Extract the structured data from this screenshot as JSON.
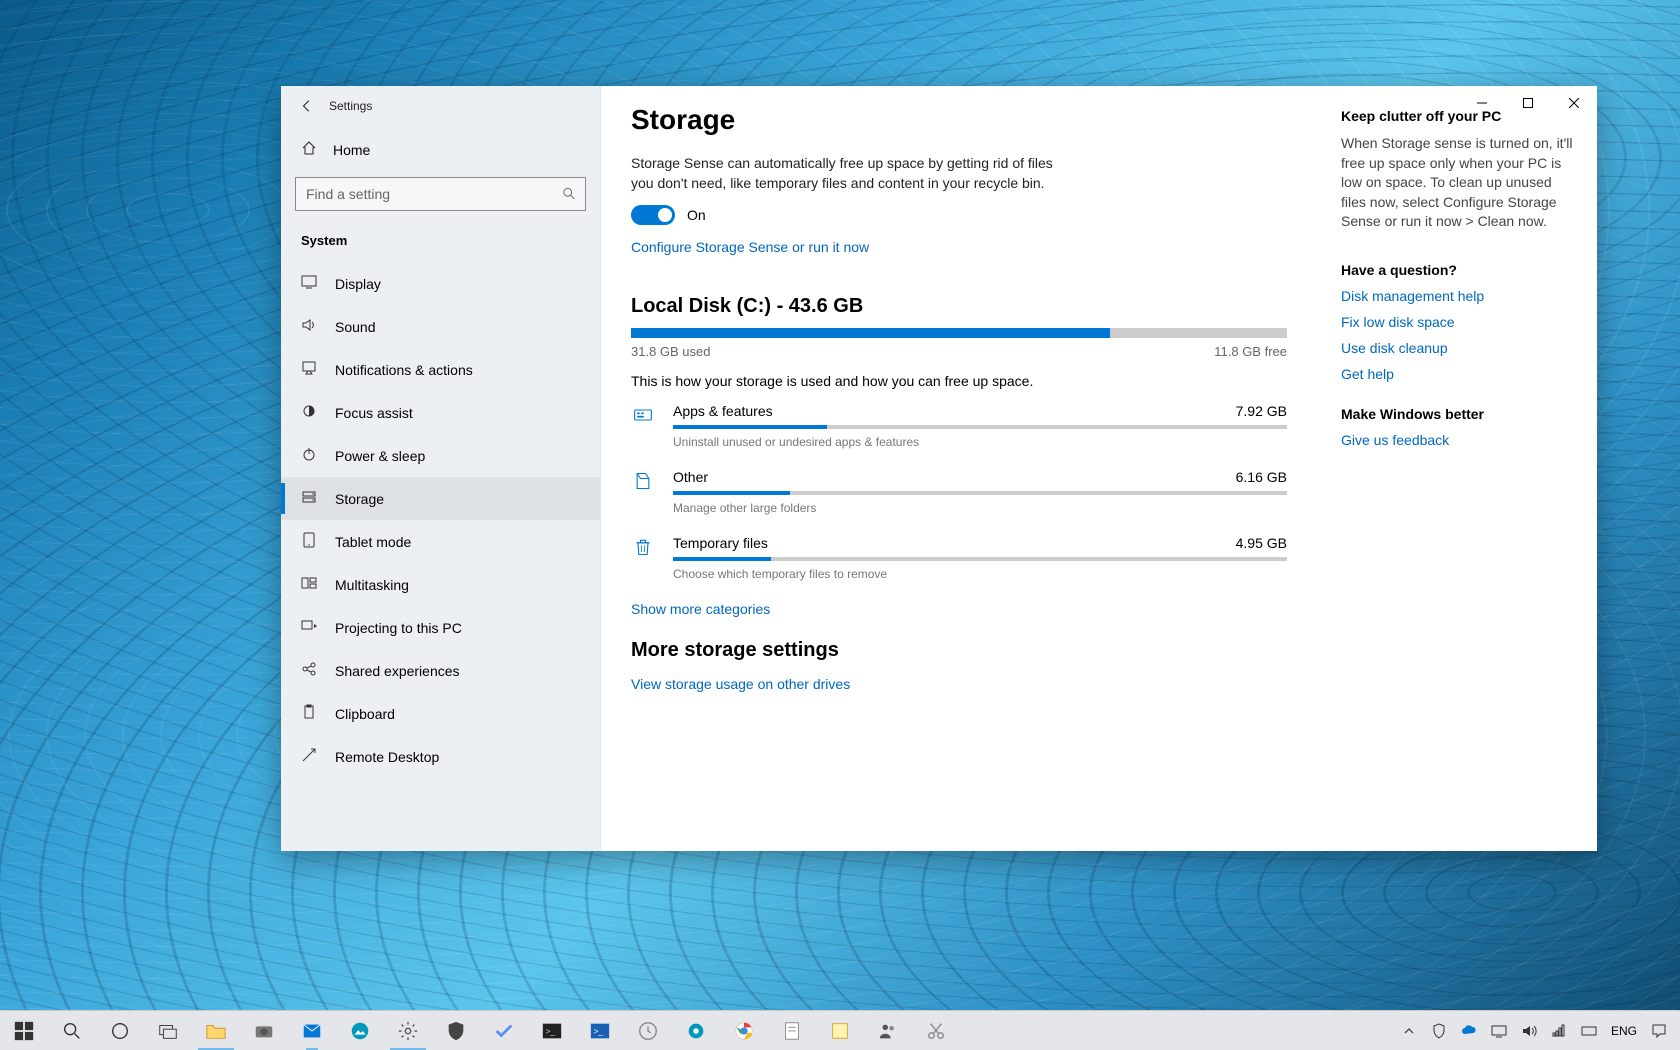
{
  "window": {
    "title": "Settings"
  },
  "sidebar": {
    "home": "Home",
    "search_placeholder": "Find a setting",
    "category": "System",
    "items": [
      {
        "label": "Display",
        "icon": "display"
      },
      {
        "label": "Sound",
        "icon": "sound"
      },
      {
        "label": "Notifications & actions",
        "icon": "notifications"
      },
      {
        "label": "Focus assist",
        "icon": "focus"
      },
      {
        "label": "Power & sleep",
        "icon": "power"
      },
      {
        "label": "Storage",
        "icon": "storage",
        "active": true
      },
      {
        "label": "Tablet mode",
        "icon": "tablet"
      },
      {
        "label": "Multitasking",
        "icon": "multitask"
      },
      {
        "label": "Projecting to this PC",
        "icon": "project"
      },
      {
        "label": "Shared experiences",
        "icon": "shared"
      },
      {
        "label": "Clipboard",
        "icon": "clipboard"
      },
      {
        "label": "Remote Desktop",
        "icon": "remote"
      }
    ]
  },
  "page": {
    "title": "Storage",
    "sense_desc": "Storage Sense can automatically free up space by getting rid of files you don't need, like temporary files and content in your recycle bin.",
    "toggle_state": "On",
    "configure_link": "Configure Storage Sense or run it now",
    "disk_title": "Local Disk (C:) - 43.6 GB",
    "disk_used": "31.8 GB used",
    "disk_free": "11.8 GB free",
    "disk_used_pct": 73,
    "usage_desc": "This is how your storage is used and how you can free up space.",
    "categories": [
      {
        "name": "Apps & features",
        "size": "7.92 GB",
        "pct": 25,
        "hint": "Uninstall unused or undesired apps & features",
        "icon": "apps"
      },
      {
        "name": "Other",
        "size": "6.16 GB",
        "pct": 19,
        "hint": "Manage other large folders",
        "icon": "other"
      },
      {
        "name": "Temporary files",
        "size": "4.95 GB",
        "pct": 16,
        "hint": "Choose which temporary files to remove",
        "icon": "trash"
      }
    ],
    "show_more": "Show more categories",
    "more_title": "More storage settings",
    "more_link": "View storage usage on other drives"
  },
  "right": {
    "h1": "Keep clutter off your PC",
    "p1": "When Storage sense is turned on, it'll free up space only when your PC is low on space. To clean up unused files now, select Configure Storage Sense or run it now > Clean now.",
    "h2": "Have a question?",
    "links": [
      "Disk management help",
      "Fix low disk space",
      "Use disk cleanup",
      "Get help"
    ],
    "h3": "Make Windows better",
    "feedback": "Give us feedback"
  },
  "taskbar": {
    "lang": "ENG"
  }
}
